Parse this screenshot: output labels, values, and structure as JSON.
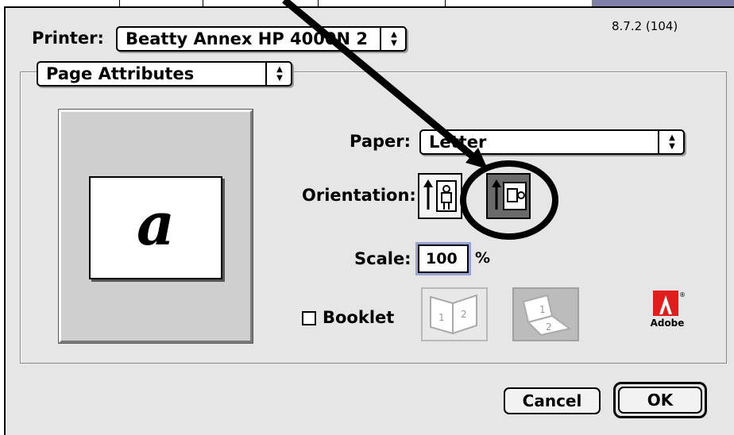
{
  "dialog": {
    "version": "8.7.2 (104)",
    "printer": {
      "label": "Printer:",
      "value": "Beatty Annex HP 4000N 2"
    },
    "panel": {
      "value": "Page Attributes"
    },
    "preview_glyph": "a",
    "paper": {
      "label": "Paper:",
      "value": "Letter"
    },
    "orientation": {
      "label": "Orientation:",
      "options": [
        "portrait",
        "landscape"
      ],
      "selected": "landscape"
    },
    "scale": {
      "label": "Scale:",
      "value": "100",
      "unit": "%"
    },
    "booklet": {
      "label": "Booklet",
      "checked": false
    },
    "logo": {
      "text": "Adobe"
    },
    "buttons": {
      "cancel": "Cancel",
      "ok": "OK"
    }
  },
  "colors": {
    "dialog_bg": "#e6e6e6",
    "focus_ring": "#9aa3d6",
    "adobe_red": "#e01e1e"
  }
}
